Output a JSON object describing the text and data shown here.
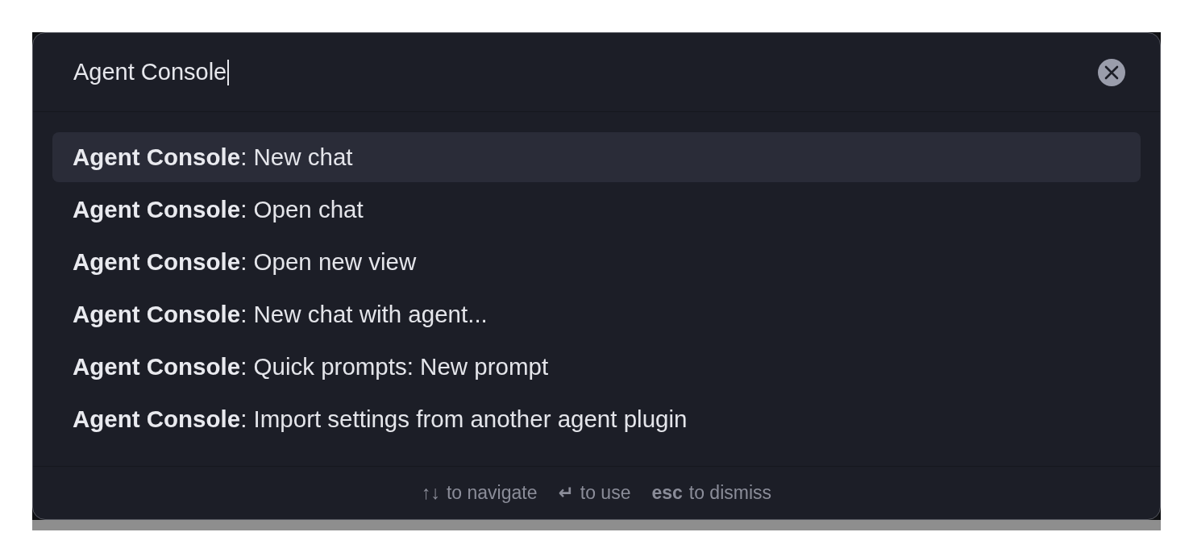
{
  "palette": {
    "search": {
      "value": "Agent Console",
      "focused": true
    },
    "results": [
      {
        "text": "**Agent Console**: New chat",
        "selected": true
      },
      {
        "text": "**Agent Console**: Open chat",
        "selected": false
      },
      {
        "text": "**Agent Console**: Open new view",
        "selected": false
      },
      {
        "text": "**Agent Console**: New chat with agent...",
        "selected": false
      },
      {
        "text": "**Agent Console**: Quick prompts: New prompt",
        "selected": false
      },
      {
        "text": "**Agent Console**: Import settings from another agent plugin",
        "selected": false
      }
    ],
    "hints": [
      {
        "key": "↑↓",
        "text": "to navigate"
      },
      {
        "key": "↵",
        "text": "to use"
      },
      {
        "key": "esc",
        "text": "to dismiss"
      }
    ]
  }
}
